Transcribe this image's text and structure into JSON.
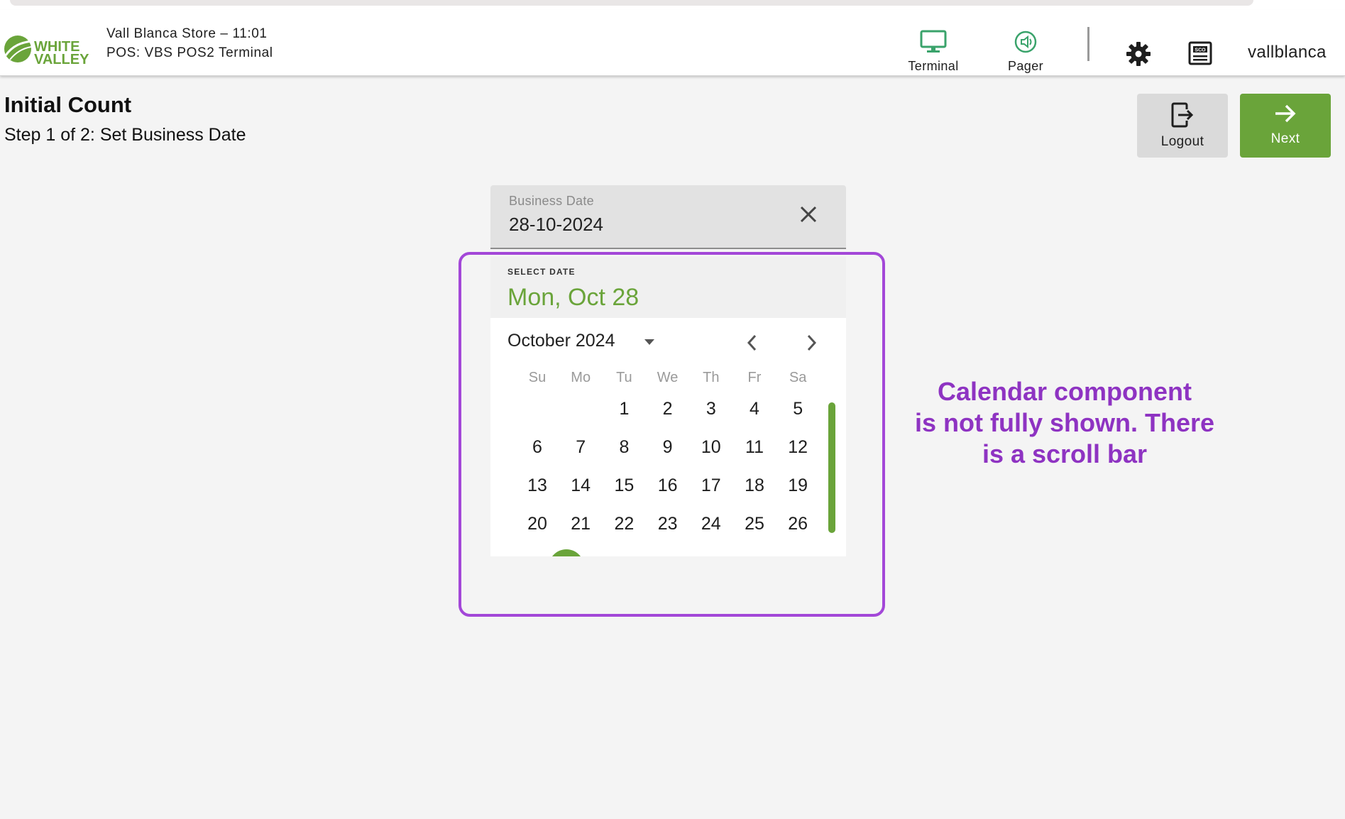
{
  "header": {
    "logo_line1": "WHITE",
    "logo_line2": "VALLEY",
    "store_line": "Vall Blanca Store – 11:01",
    "pos_line": "POS: VBS POS2 Terminal",
    "nav": [
      {
        "label": "Terminal",
        "icon": "monitor-icon"
      },
      {
        "label": "Pager",
        "icon": "pager-icon"
      }
    ],
    "settings_icon": "gear-icon",
    "sco_icon": "sco-icon",
    "sco_label": "SCO",
    "username": "vallblanca"
  },
  "page": {
    "title": "Initial Count",
    "subtitle": "Step 1 of 2: Set Business Date"
  },
  "actions": {
    "logout_label": "Logout",
    "next_label": "Next"
  },
  "date_field": {
    "label": "Business Date",
    "value": "28-10-2024"
  },
  "picker": {
    "caption": "SELECT DATE",
    "selected_display": "Mon, Oct 28",
    "month_label": "October 2024",
    "weekdays": [
      "Su",
      "Mo",
      "Tu",
      "We",
      "Th",
      "Fr",
      "Sa"
    ],
    "weeks": [
      [
        "",
        "",
        "1",
        "2",
        "3",
        "4",
        "5"
      ],
      [
        "6",
        "7",
        "8",
        "9",
        "10",
        "11",
        "12"
      ],
      [
        "13",
        "14",
        "15",
        "16",
        "17",
        "18",
        "19"
      ],
      [
        "20",
        "21",
        "22",
        "23",
        "24",
        "25",
        "26"
      ]
    ]
  },
  "annotation": {
    "line1": "Calendar component",
    "line2": "is not fully shown. There",
    "line3": "is a scroll bar"
  },
  "colors": {
    "brand_green": "#6aa43a",
    "annotation_purple": "#a347d8"
  }
}
